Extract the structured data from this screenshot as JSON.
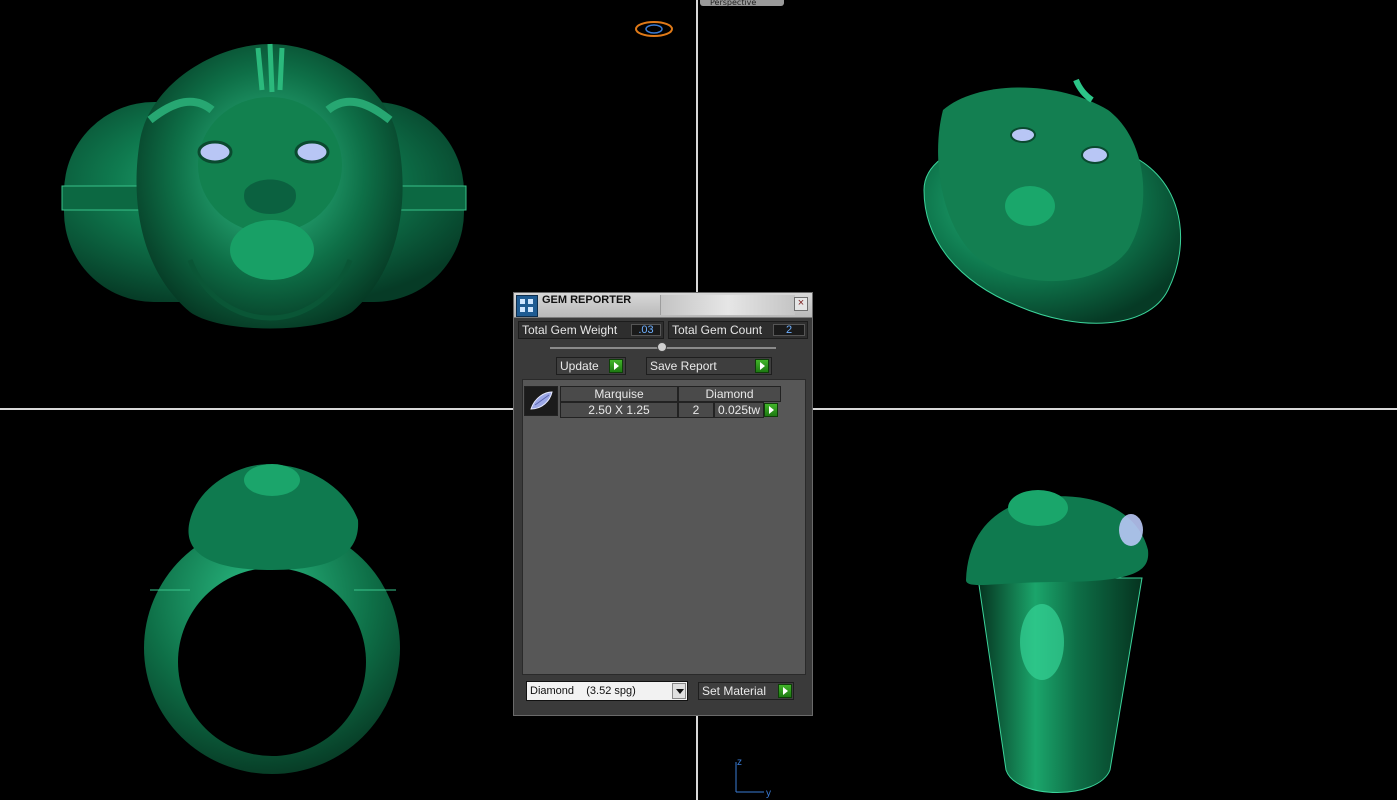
{
  "viewports": {
    "top_left": "front-view",
    "top_right": "perspective-view",
    "bottom_left": "side-view",
    "bottom_right": "side-view-alt",
    "top_right_tab": "Perspective"
  },
  "axis": {
    "z": "z",
    "y": "y"
  },
  "colors": {
    "model": "#0f7a4f",
    "gem": "#b8c6f5",
    "viewport_bg": "#000000",
    "accent_green": "#2f9a1d",
    "value_text": "#6fb0ff"
  },
  "gem_reporter": {
    "title": "GEM REPORTER",
    "close_icon": "close-icon",
    "total_weight_label": "Total Gem Weight",
    "total_weight_value": ".03",
    "total_count_label": "Total Gem Count",
    "total_count_value": "2",
    "update_label": "Update",
    "save_report_label": "Save Report",
    "gems": [
      {
        "icon": "marquise-gem-icon",
        "shape": "Marquise",
        "material": "Diamond",
        "size": "2.50 X 1.25",
        "count": "2",
        "weight": "0.025tw"
      }
    ],
    "material_select": "Diamond    (3.52 spg)",
    "set_material_label": "Set Material"
  }
}
